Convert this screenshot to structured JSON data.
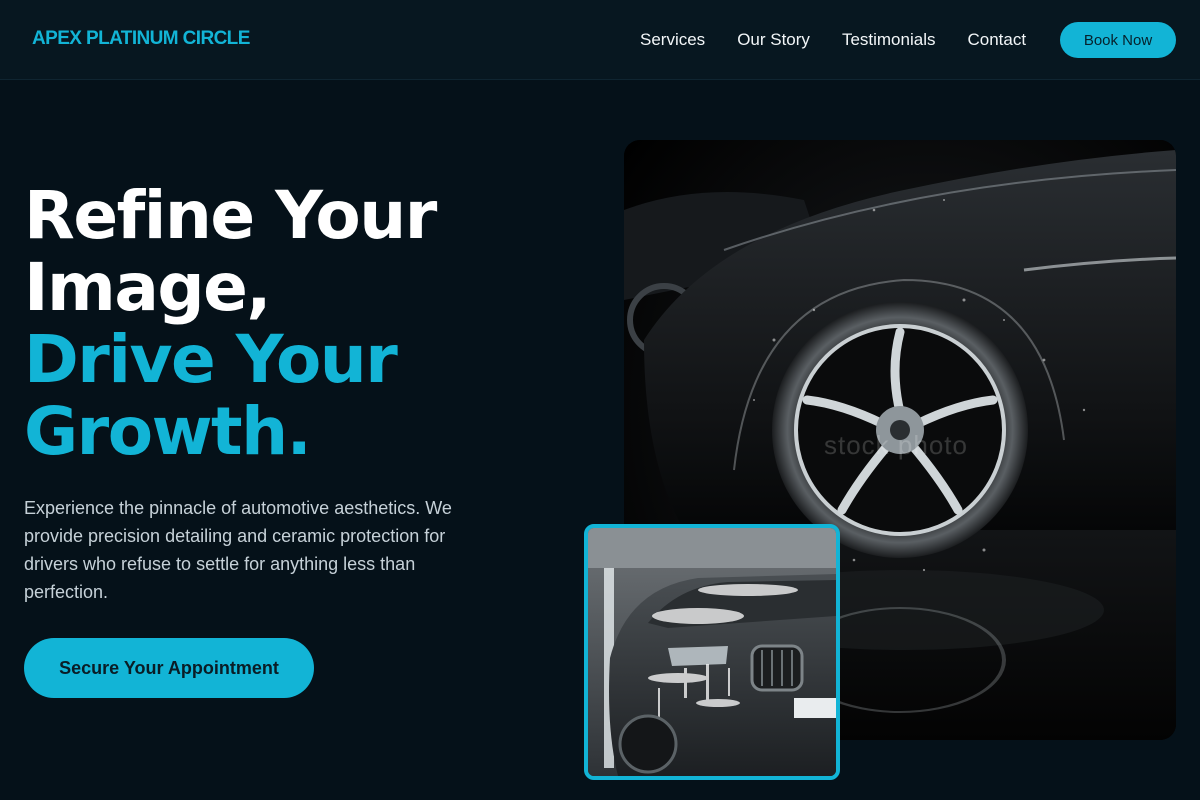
{
  "brand": {
    "name": "APEX PLATINUM CIRCLE"
  },
  "nav": {
    "items": [
      "Services",
      "Our Story",
      "Testimonials",
      "Contact"
    ],
    "book_label": "Book Now"
  },
  "hero": {
    "title_line1": "Refine Your",
    "title_line2": "Image,",
    "title_line3": "Drive Your",
    "title_line4": "Growth.",
    "description": "Experience the pinnacle of automotive aesthetics. We provide precision detailing and ceramic protection for drivers who refuse to settle for anything less than perfection.",
    "cta_label": "Secure Your Appointment"
  },
  "images": {
    "main_alt": "Black sports car wheel covered in water droplets",
    "secondary_alt": "Dark SUV covered in wash foam",
    "watermark": "stock photo"
  },
  "colors": {
    "background": "#051119",
    "header": "#071720",
    "accent": "#12b4d6",
    "text": "#ffffff",
    "muted_text": "#c6d1d8"
  }
}
